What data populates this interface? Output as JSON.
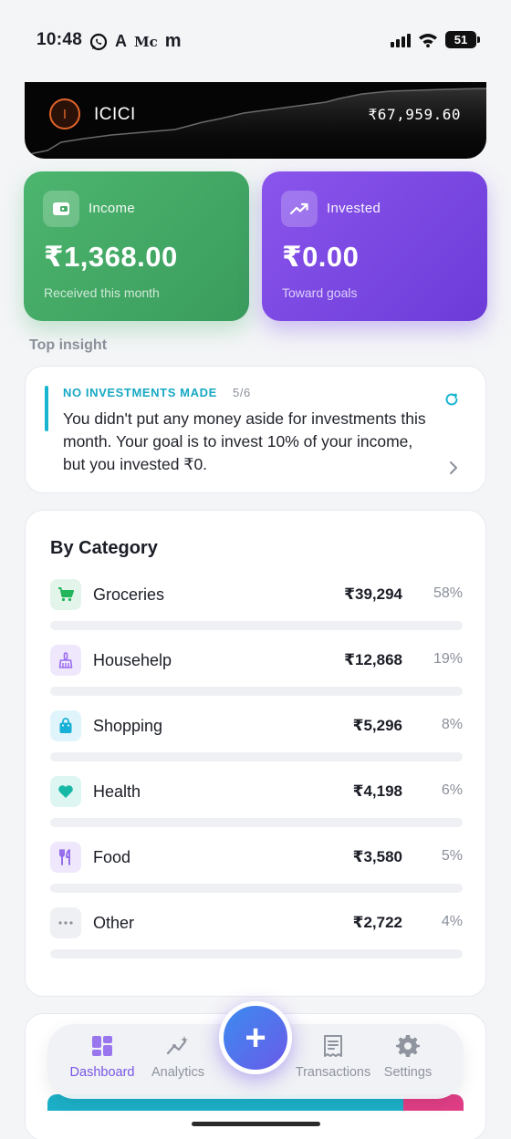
{
  "status_bar": {
    "time": "10:48",
    "app_letters": [
      "A",
      "Mc",
      "m"
    ],
    "battery": "51"
  },
  "account": {
    "bank_initial": "I",
    "bank_name": "ICICI",
    "balance": "₹67,959.60"
  },
  "stats": {
    "income": {
      "label": "Income",
      "value": "₹1,368.00",
      "sub": "Received this month",
      "color": "#4cb56e"
    },
    "invested": {
      "label": "Invested",
      "value": "₹0.00",
      "sub": "Toward goals",
      "color": "#7a48e6"
    }
  },
  "insight": {
    "section_label": "Top insight",
    "tag": "NO INVESTMENTS MADE",
    "count": "5/6",
    "text": "You didn't put any money aside for investments this month. Your goal is to invest 10% of your income, but you invested ₹0."
  },
  "categories": {
    "title": "By Category",
    "items": [
      {
        "name": "Groceries",
        "amount": "₹39,294",
        "percent": "58%",
        "share": 0.58,
        "icon": "cart-icon",
        "color": "#22b55a",
        "bg": "#e3f5ea"
      },
      {
        "name": "Househelp",
        "amount": "₹12,868",
        "percent": "19%",
        "share": 0.19,
        "icon": "broom-icon",
        "color": "#9b6cf0",
        "bg": "#efe8fd"
      },
      {
        "name": "Shopping",
        "amount": "₹5,296",
        "percent": "8%",
        "share": 0.08,
        "icon": "shopping-bag-icon",
        "color": "#18b0d6",
        "bg": "#e0f5fb"
      },
      {
        "name": "Health",
        "amount": "₹4,198",
        "percent": "6%",
        "share": 0.06,
        "icon": "heart-icon",
        "color": "#18b8a6",
        "bg": "#def6f2"
      },
      {
        "name": "Food",
        "amount": "₹3,580",
        "percent": "5%",
        "share": 0.05,
        "icon": "utensils-icon",
        "color": "#8d63ea",
        "bg": "#efe8fd"
      },
      {
        "name": "Other",
        "amount": "₹2,722",
        "percent": "4%",
        "share": 0.04,
        "icon": "more-icon",
        "color": "#8a8f9a",
        "bg": "#eef0f3"
      }
    ]
  },
  "nav": {
    "tabs": [
      {
        "label": "Dashboard",
        "icon": "dashboard-icon",
        "active": true
      },
      {
        "label": "Analytics",
        "icon": "analytics-icon",
        "active": false
      },
      {
        "label": "Transactions",
        "icon": "receipt-icon",
        "active": false
      },
      {
        "label": "Settings",
        "icon": "gear-icon",
        "active": false
      }
    ],
    "add_symbol": "+"
  },
  "colors": {
    "accent": "#7b55e6",
    "insight": "#17a8c4",
    "card_dark": "#050505"
  }
}
